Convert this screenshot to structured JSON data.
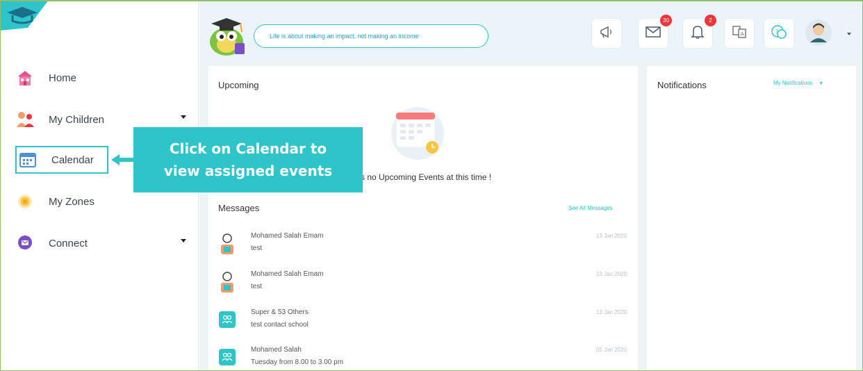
{
  "header": {
    "quote": "Life is about making an impact, not making an income",
    "badges": {
      "messages": "30",
      "notifications": "2"
    },
    "icons": [
      "megaphone-icon",
      "envelope-icon",
      "bell-icon",
      "translate-icon",
      "help-chat-icon",
      "user-avatar"
    ]
  },
  "sidebar": {
    "items": [
      {
        "label": "Home",
        "icon": "home-icon"
      },
      {
        "label": "My Children",
        "icon": "children-icon"
      },
      {
        "label": "Calendar",
        "icon": "calendar-icon"
      },
      {
        "label": "My Zones",
        "icon": "zones-icon"
      },
      {
        "label": "Connect",
        "icon": "connect-icon"
      }
    ]
  },
  "callout": {
    "line1": "Click on Calendar to",
    "line2": "view assigned events"
  },
  "upcoming": {
    "title": "Upcoming",
    "empty_text": "s no Upcoming Events at this time !"
  },
  "messages": {
    "title": "Messages",
    "see_all": "See All Messages",
    "items": [
      {
        "name": "Mohamed Salah Emam",
        "text": "test",
        "date": "13 Jan 2020",
        "avatar": "person-avatar"
      },
      {
        "name": "Mohamed Salah Emam",
        "text": "test",
        "date": "13 Jan 2020",
        "avatar": "person-avatar"
      },
      {
        "name": "Super & 53 Others",
        "text": "test contact school",
        "date": "13 Jan 2020",
        "avatar": "group-icon"
      },
      {
        "name": "Mohamed Salah",
        "text": "Tuesday from 8.00 to 3.00 pm",
        "date": "05 Jan 2020",
        "avatar": "group-icon"
      }
    ]
  },
  "notifications": {
    "title": "Notifications",
    "filter": "My Notifications"
  },
  "colors": {
    "accent": "#2ec4c9",
    "topbar_bg": "#eaf4f9",
    "badge": "#e8383d"
  }
}
